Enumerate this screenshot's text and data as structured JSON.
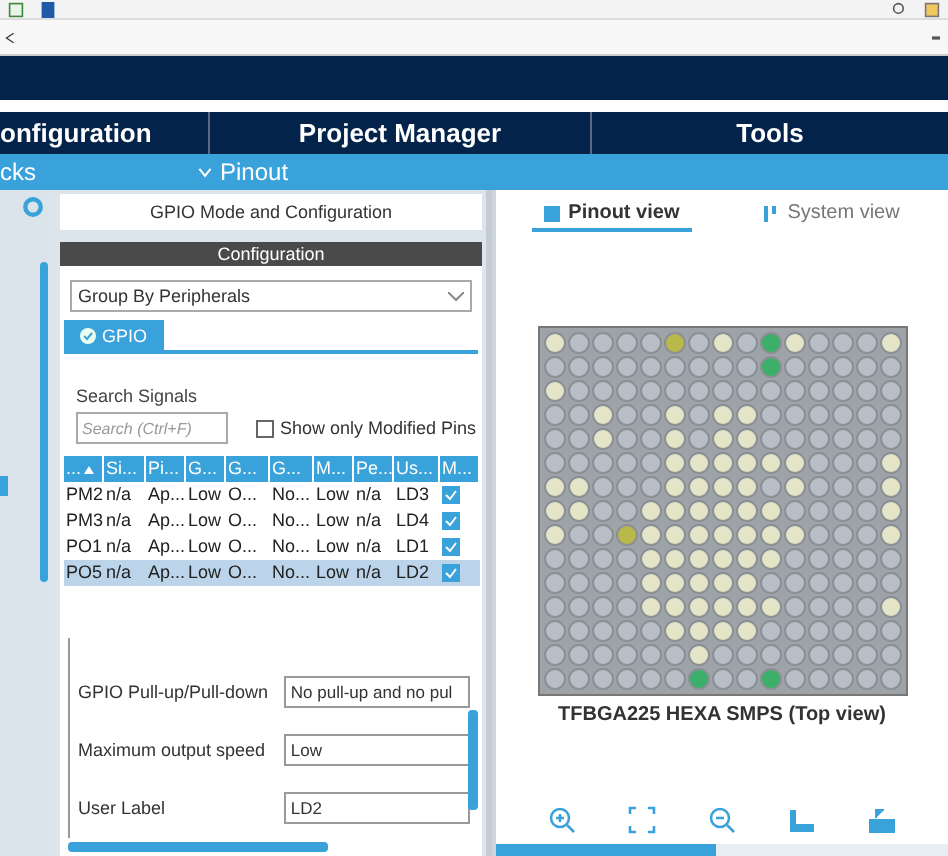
{
  "main_tabs": [
    {
      "label": "onfiguration"
    },
    {
      "label": "Project Manager"
    },
    {
      "label": "Tools"
    }
  ],
  "sub_bar": {
    "left_label": "cks",
    "pinout_label": "Pinout"
  },
  "mode_panel": {
    "title": "GPIO Mode and Configuration",
    "config_title": "Configuration",
    "group_by": "Group By Peripherals",
    "tabs": [
      {
        "label": "GPIO",
        "selected": true
      }
    ],
    "search_label": "Search Signals",
    "search_placeholder": "Search (Ctrl+F)",
    "show_modified": {
      "label": "Show only Modified Pins",
      "checked": false
    },
    "table": {
      "columns": [
        "...",
        "Si...",
        "Pi...",
        "G...",
        "G...",
        "G...",
        "M...",
        "Pe...",
        "Us...",
        "M..."
      ],
      "rows": [
        {
          "cells": [
            "PM2",
            "n/a",
            "Ap...",
            "Low",
            "O...",
            "No...",
            "Low",
            "n/a",
            "LD3"
          ],
          "checked": true,
          "selected": false
        },
        {
          "cells": [
            "PM3",
            "n/a",
            "Ap...",
            "Low",
            "O...",
            "No...",
            "Low",
            "n/a",
            "LD4"
          ],
          "checked": true,
          "selected": false
        },
        {
          "cells": [
            "PO1",
            "n/a",
            "Ap...",
            "Low",
            "O...",
            "No...",
            "Low",
            "n/a",
            "LD1"
          ],
          "checked": true,
          "selected": false
        },
        {
          "cells": [
            "PO5",
            "n/a",
            "Ap...",
            "Low",
            "O...",
            "No...",
            "Low",
            "n/a",
            "LD2"
          ],
          "checked": true,
          "selected": true
        }
      ]
    },
    "properties": [
      {
        "label": "GPIO Pull-up/Pull-down",
        "value": "No pull-up and no pul"
      },
      {
        "label": "Maximum output speed",
        "value": "Low"
      },
      {
        "label": "User Label",
        "value": "LD2"
      }
    ]
  },
  "view_tabs": [
    {
      "label": "Pinout view",
      "selected": true
    },
    {
      "label": "System view",
      "selected": false
    }
  ],
  "chip": {
    "caption": "TFBGA225 HEXA SMPS (Top view)",
    "pin_rows": [
      [
        {
          "kind": "power"
        },
        {
          "kind": "free"
        },
        {
          "kind": "free"
        },
        {
          "kind": "free"
        },
        {
          "kind": "free"
        },
        {
          "kind": "misc"
        },
        {
          "kind": "free"
        },
        {
          "kind": "power"
        },
        {
          "kind": "free"
        },
        {
          "kind": "io"
        },
        {
          "kind": "power"
        },
        {
          "kind": "free"
        },
        {
          "kind": "free"
        },
        {
          "kind": "free"
        },
        {
          "kind": "power"
        }
      ],
      [
        {
          "kind": "free"
        },
        {
          "kind": "free"
        },
        {
          "kind": "free"
        },
        {
          "kind": "free"
        },
        {
          "kind": "free"
        },
        {
          "kind": "free"
        },
        {
          "kind": "free"
        },
        {
          "kind": "free"
        },
        {
          "kind": "free"
        },
        {
          "kind": "io"
        },
        {
          "kind": "free"
        },
        {
          "kind": "free"
        },
        {
          "kind": "free"
        },
        {
          "kind": "free"
        },
        {
          "kind": "free"
        }
      ],
      [
        {
          "kind": "power"
        },
        {
          "kind": "free"
        },
        {
          "kind": "free"
        },
        {
          "kind": "free"
        },
        {
          "kind": "free"
        },
        {
          "kind": "free"
        },
        {
          "kind": "free"
        },
        {
          "kind": "free"
        },
        {
          "kind": "free"
        },
        {
          "kind": "free"
        },
        {
          "kind": "free"
        },
        {
          "kind": "free"
        },
        {
          "kind": "free"
        },
        {
          "kind": "free"
        },
        {
          "kind": "free"
        }
      ],
      [
        {
          "kind": "free"
        },
        {
          "kind": "free"
        },
        {
          "kind": "power"
        },
        {
          "kind": "free"
        },
        {
          "kind": "free"
        },
        {
          "kind": "power"
        },
        {
          "kind": "free"
        },
        {
          "kind": "power"
        },
        {
          "kind": "power"
        },
        {
          "kind": "free"
        },
        {
          "kind": "free"
        },
        {
          "kind": "free"
        },
        {
          "kind": "free"
        },
        {
          "kind": "free"
        },
        {
          "kind": "free"
        }
      ],
      [
        {
          "kind": "free"
        },
        {
          "kind": "free"
        },
        {
          "kind": "power"
        },
        {
          "kind": "free"
        },
        {
          "kind": "free"
        },
        {
          "kind": "power"
        },
        {
          "kind": "free"
        },
        {
          "kind": "power"
        },
        {
          "kind": "power"
        },
        {
          "kind": "free"
        },
        {
          "kind": "free"
        },
        {
          "kind": "free"
        },
        {
          "kind": "free"
        },
        {
          "kind": "free"
        },
        {
          "kind": "free"
        }
      ],
      [
        {
          "kind": "free"
        },
        {
          "kind": "free"
        },
        {
          "kind": "free"
        },
        {
          "kind": "free"
        },
        {
          "kind": "free"
        },
        {
          "kind": "power"
        },
        {
          "kind": "power"
        },
        {
          "kind": "power"
        },
        {
          "kind": "power"
        },
        {
          "kind": "power"
        },
        {
          "kind": "power"
        },
        {
          "kind": "free"
        },
        {
          "kind": "free"
        },
        {
          "kind": "free"
        },
        {
          "kind": "power"
        }
      ],
      [
        {
          "kind": "power"
        },
        {
          "kind": "power"
        },
        {
          "kind": "free"
        },
        {
          "kind": "free"
        },
        {
          "kind": "free"
        },
        {
          "kind": "power"
        },
        {
          "kind": "power"
        },
        {
          "kind": "power"
        },
        {
          "kind": "power"
        },
        {
          "kind": "free"
        },
        {
          "kind": "power"
        },
        {
          "kind": "free"
        },
        {
          "kind": "free"
        },
        {
          "kind": "free"
        },
        {
          "kind": "power"
        }
      ],
      [
        {
          "kind": "power"
        },
        {
          "kind": "power"
        },
        {
          "kind": "free"
        },
        {
          "kind": "free"
        },
        {
          "kind": "power"
        },
        {
          "kind": "power"
        },
        {
          "kind": "power"
        },
        {
          "kind": "power"
        },
        {
          "kind": "power"
        },
        {
          "kind": "power"
        },
        {
          "kind": "free"
        },
        {
          "kind": "free"
        },
        {
          "kind": "free"
        },
        {
          "kind": "free"
        },
        {
          "kind": "power"
        }
      ],
      [
        {
          "kind": "power"
        },
        {
          "kind": "free"
        },
        {
          "kind": "free"
        },
        {
          "kind": "misc"
        },
        {
          "kind": "power"
        },
        {
          "kind": "power"
        },
        {
          "kind": "power"
        },
        {
          "kind": "power"
        },
        {
          "kind": "power"
        },
        {
          "kind": "power"
        },
        {
          "kind": "power"
        },
        {
          "kind": "free"
        },
        {
          "kind": "free"
        },
        {
          "kind": "free"
        },
        {
          "kind": "power"
        }
      ],
      [
        {
          "kind": "free"
        },
        {
          "kind": "free"
        },
        {
          "kind": "free"
        },
        {
          "kind": "free"
        },
        {
          "kind": "power"
        },
        {
          "kind": "power"
        },
        {
          "kind": "power"
        },
        {
          "kind": "power"
        },
        {
          "kind": "power"
        },
        {
          "kind": "power"
        },
        {
          "kind": "free"
        },
        {
          "kind": "free"
        },
        {
          "kind": "free"
        },
        {
          "kind": "free"
        },
        {
          "kind": "free"
        }
      ],
      [
        {
          "kind": "free"
        },
        {
          "kind": "free"
        },
        {
          "kind": "free"
        },
        {
          "kind": "free"
        },
        {
          "kind": "power"
        },
        {
          "kind": "power"
        },
        {
          "kind": "power"
        },
        {
          "kind": "power"
        },
        {
          "kind": "power"
        },
        {
          "kind": "free"
        },
        {
          "kind": "free"
        },
        {
          "kind": "free"
        },
        {
          "kind": "free"
        },
        {
          "kind": "free"
        },
        {
          "kind": "free"
        }
      ],
      [
        {
          "kind": "free"
        },
        {
          "kind": "free"
        },
        {
          "kind": "free"
        },
        {
          "kind": "free"
        },
        {
          "kind": "power"
        },
        {
          "kind": "power"
        },
        {
          "kind": "power"
        },
        {
          "kind": "power"
        },
        {
          "kind": "power"
        },
        {
          "kind": "power"
        },
        {
          "kind": "free"
        },
        {
          "kind": "free"
        },
        {
          "kind": "free"
        },
        {
          "kind": "free"
        },
        {
          "kind": "power"
        }
      ],
      [
        {
          "kind": "free"
        },
        {
          "kind": "free"
        },
        {
          "kind": "free"
        },
        {
          "kind": "free"
        },
        {
          "kind": "free"
        },
        {
          "kind": "power"
        },
        {
          "kind": "power"
        },
        {
          "kind": "power"
        },
        {
          "kind": "power"
        },
        {
          "kind": "free"
        },
        {
          "kind": "free"
        },
        {
          "kind": "free"
        },
        {
          "kind": "free"
        },
        {
          "kind": "free"
        },
        {
          "kind": "free"
        }
      ],
      [
        {
          "kind": "free"
        },
        {
          "kind": "free"
        },
        {
          "kind": "free"
        },
        {
          "kind": "free"
        },
        {
          "kind": "free"
        },
        {
          "kind": "free"
        },
        {
          "kind": "power"
        },
        {
          "kind": "free"
        },
        {
          "kind": "free"
        },
        {
          "kind": "free"
        },
        {
          "kind": "free"
        },
        {
          "kind": "free"
        },
        {
          "kind": "free"
        },
        {
          "kind": "free"
        },
        {
          "kind": "free"
        }
      ],
      [
        {
          "kind": "free"
        },
        {
          "kind": "free"
        },
        {
          "kind": "free"
        },
        {
          "kind": "free"
        },
        {
          "kind": "free"
        },
        {
          "kind": "free"
        },
        {
          "kind": "io"
        },
        {
          "kind": "free"
        },
        {
          "kind": "free"
        },
        {
          "kind": "io"
        },
        {
          "kind": "free"
        },
        {
          "kind": "free"
        },
        {
          "kind": "free"
        },
        {
          "kind": "free"
        },
        {
          "kind": "free"
        }
      ]
    ]
  }
}
